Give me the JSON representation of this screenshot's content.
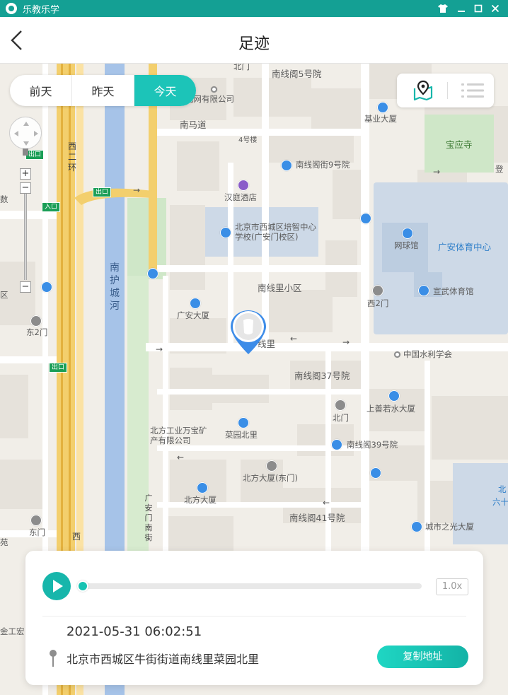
{
  "window": {
    "app_title": "乐教乐学",
    "controls": [
      "skin-icon",
      "minimize-icon",
      "maximize-icon",
      "close-icon"
    ]
  },
  "header": {
    "title": "足迹",
    "back_icon": "chevron-left-icon"
  },
  "day_tabs": [
    {
      "label": "前天",
      "active": false
    },
    {
      "label": "昨天",
      "active": false
    },
    {
      "label": "今天",
      "active": true
    }
  ],
  "view_toggle": {
    "map_icon": "map-pin-icon",
    "list_icon": "list-icon"
  },
  "map": {
    "labels": {
      "north_gate": "北门",
      "nanxian5": "南线阁5号院",
      "telecom": "电网有限公司",
      "nanma": "南马道",
      "bldg4": "4号楼",
      "jiye": "基业大厦",
      "baoying": "宝应寺",
      "nanxian9": "南线阁街9号院",
      "deng": "登",
      "hanting": "汉庭酒店",
      "peizhi": "北京市西城区培智中心学校(广安门校区)",
      "tennis": "网球馆",
      "guangan_sports": "广安体育中心",
      "nanxianli_xiaoqu": "南线里小区",
      "xuanwu": "宣武体育馆",
      "xi2men": "西2门",
      "guangan_bldg": "广安大厦",
      "nanxianli": "线里",
      "water_soc": "中国水利学会",
      "nanxian37": "南线阁37号院",
      "shangshan": "上善若水大厦",
      "beimen2": "北门",
      "wanbao": "北方工业万宝矿产有限公司",
      "caiyuan": "菜园北里",
      "nanxian39": "南线阁39号院",
      "beifang_east": "北方大厦(东门)",
      "beifang": "北方大厦",
      "nanxian41": "南线阁41号院",
      "chengshi": "城市之光大厦",
      "dong2men": "东2门",
      "dongmen": "东门",
      "shu": "数",
      "qu": "区",
      "yuan": "苑",
      "jingong": "金工宏",
      "bei": "北",
      "liu": "六十",
      "south_moat": "南护城河",
      "west2ring": "西二环",
      "xi": "西",
      "guanganmen_nan": "广安门南街",
      "exit_label": "出口",
      "entrance_label": "入口"
    }
  },
  "playback": {
    "speed": "1.0x",
    "progress": 0.0
  },
  "record": {
    "datetime": "2021-05-31 06:02:51",
    "address": "北京市西城区牛街街道南线里菜园北里",
    "copy_button": "复制地址"
  }
}
